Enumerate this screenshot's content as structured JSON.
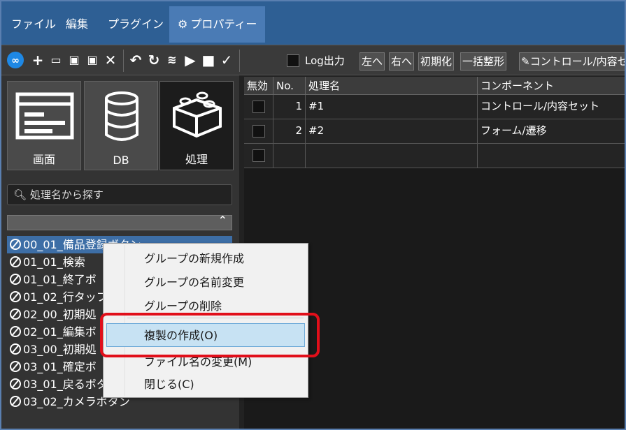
{
  "menubar": {
    "items": [
      "ファイル",
      "編集",
      "プラグイン"
    ],
    "active_label": "プロパティー",
    "active_icon": "gear-icon",
    "background": "#2e5f94",
    "active_background": "#4a7bb5"
  },
  "toolbar": {
    "icons": [
      "infinity-logo-icon",
      "plus-icon",
      "folder-icon",
      "save-icon",
      "save-as-icon",
      "close-icon",
      "undo-icon",
      "refresh-icon",
      "wifi-icon",
      "play-icon",
      "stop-icon",
      "check-icon"
    ],
    "log_label": "Log出力",
    "left_btn": "左へ",
    "right_btn": "右へ",
    "init_btn": "初期化",
    "format_btn": "一括整形",
    "control_text": "コントロール/内容セ"
  },
  "categories": [
    {
      "label": "画面",
      "icon": "screen-icon"
    },
    {
      "label": "DB",
      "icon": "database-icon"
    },
    {
      "label": "処理",
      "icon": "blocks-icon"
    }
  ],
  "search": {
    "placeholder": "処理名から探す"
  },
  "tree": {
    "items": [
      "00_01_備品登録ボタン",
      "01_01_検索",
      "01_01_終了ボ",
      "01_02_行タッフ",
      "02_00_初期処",
      "02_01_編集ボ",
      "03_00_初期処",
      "03_01_確定ボ",
      "03_01_戻るボタン",
      "03_02_カメラボタン"
    ]
  },
  "grid": {
    "headers": {
      "disabled": "無効",
      "no": "No.",
      "name": "処理名",
      "component": "コンポーネント"
    },
    "rows": [
      {
        "no": "1",
        "name": "#1",
        "component": "コントロール/内容セット"
      },
      {
        "no": "2",
        "name": "#2",
        "component": "フォーム/遷移"
      },
      {
        "no": "",
        "name": "",
        "component": ""
      }
    ]
  },
  "context_menu": {
    "items": [
      "グループの新規作成",
      "グループの名前変更",
      "グループの削除",
      "複製の作成(O)",
      "ファイル名の変更(M)",
      "閉じる(C)"
    ],
    "highlight_color": "#c7e2f3",
    "ring_color": "#e10f1a"
  }
}
